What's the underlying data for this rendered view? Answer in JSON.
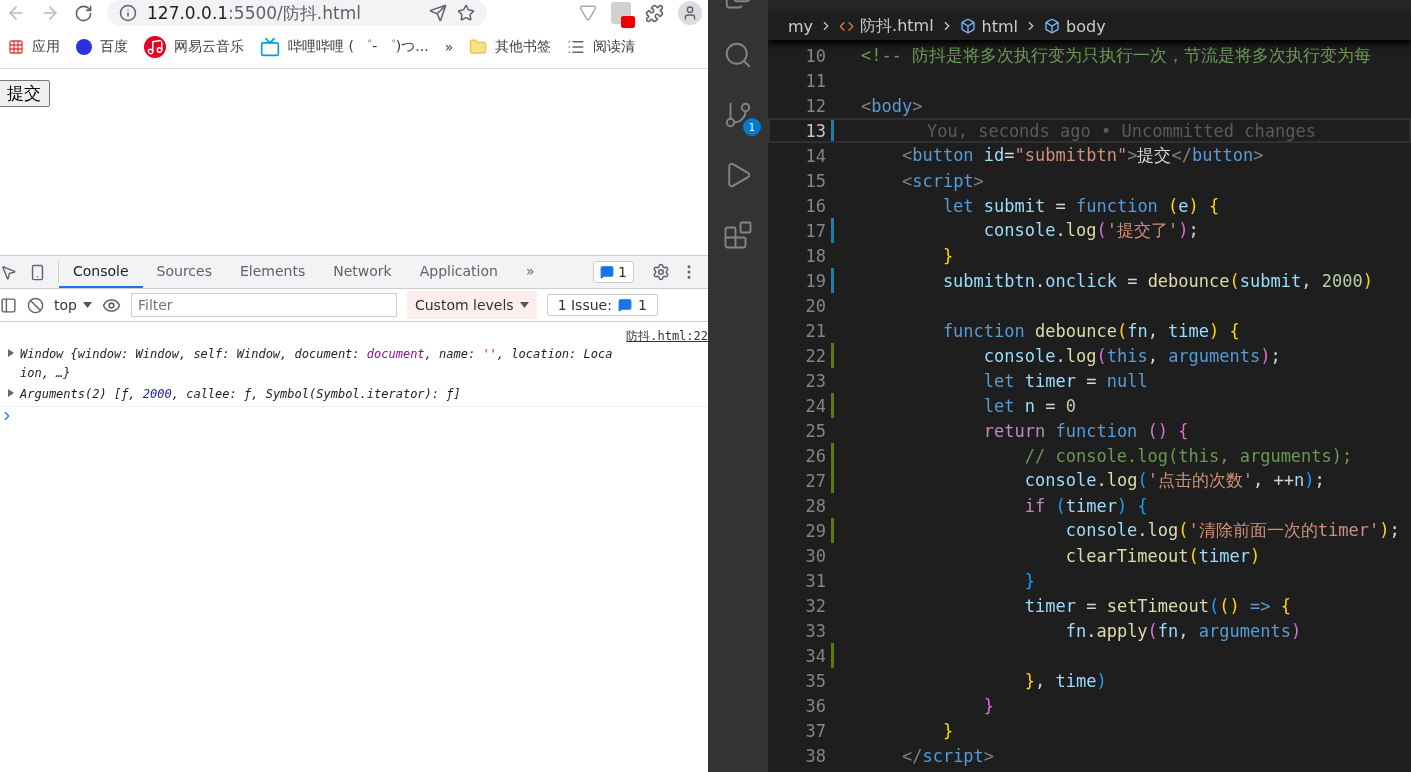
{
  "browser": {
    "address_host": "127.0.0.1",
    "address_rest": ":5500/防抖.html",
    "bookmarks": [
      {
        "label": "应用"
      },
      {
        "label": "百度"
      },
      {
        "label": "网易云音乐"
      },
      {
        "label": "哔哩哔哩 ( ゜- ゜)つ..."
      },
      {
        "label": "»"
      },
      {
        "label": "其他书签"
      },
      {
        "label": "阅读清"
      }
    ],
    "page_button": "提交"
  },
  "devtools": {
    "tabs": [
      {
        "label": "Console",
        "selected": true
      },
      {
        "label": "Sources",
        "selected": false
      },
      {
        "label": "Elements",
        "selected": false
      },
      {
        "label": "Network",
        "selected": false
      },
      {
        "label": "Application",
        "selected": false
      }
    ],
    "more_tabs": "»",
    "messages_count": "1",
    "context": "top",
    "filter_placeholder": "Filter",
    "levels": "Custom levels",
    "issues_label": "1 Issue:",
    "issues_count": "1",
    "source_link": "防抖.html:22",
    "entries": [
      {
        "lines": [
          [
            {
              "text": "Window {window: Window, self: Window, document: ",
              "kind": "plain"
            },
            {
              "text": "document",
              "kind": "object"
            },
            {
              "text": ", name: ",
              "kind": "plain"
            },
            {
              "text": "''",
              "kind": "string"
            },
            {
              "text": ", location: Loca",
              "kind": "plain"
            }
          ],
          [
            {
              "text": "ion, …}",
              "kind": "plain"
            }
          ]
        ]
      },
      {
        "lines": [
          [
            {
              "text": "Arguments(2) [ƒ, ",
              "kind": "plain"
            },
            {
              "text": "2000",
              "kind": "number"
            },
            {
              "text": ", callee: ƒ, Symbol(Symbol.iterator): ƒ]",
              "kind": "plain"
            }
          ]
        ]
      }
    ]
  },
  "vscode": {
    "scm_badge": "1",
    "breadcrumbs": [
      {
        "label": "my"
      },
      {
        "label": "防抖.html"
      },
      {
        "label": "html"
      },
      {
        "label": "body"
      }
    ],
    "lines": [
      {
        "number": "10",
        "current": false,
        "tokens": [
          {
            "text": "<!-- 防抖是将多次执行变为只执行一次，节流是将多次执行变为每",
            "kind": "comment"
          }
        ]
      },
      {
        "number": "11",
        "current": false
      },
      {
        "number": "12",
        "current": false,
        "tokens": [
          {
            "text": "<",
            "kind": "punct"
          },
          {
            "text": "body",
            "kind": "tag"
          },
          {
            "text": ">",
            "kind": "punct"
          }
        ]
      },
      {
        "number": "13",
        "current": true,
        "blame": "You, seconds ago • Uncommitted changes",
        "kind": "modified"
      },
      {
        "number": "14",
        "current": false,
        "tokens": [
          {
            "text": "    <",
            "kind": "punct"
          },
          {
            "text": "button ",
            "kind": "tag"
          },
          {
            "text": "id",
            "kind": "attr"
          },
          {
            "text": "=",
            "kind": "plain"
          },
          {
            "text": "\"submitbtn\"",
            "kind": "string"
          },
          {
            "text": ">",
            "kind": "punct"
          },
          {
            "text": "提交",
            "kind": "plain"
          },
          {
            "text": "</",
            "kind": "punct"
          },
          {
            "text": "button",
            "kind": "tag"
          },
          {
            "text": ">",
            "kind": "punct"
          }
        ]
      },
      {
        "number": "15",
        "current": false,
        "tokens": [
          {
            "text": "    <",
            "kind": "punct"
          },
          {
            "text": "script",
            "kind": "tag"
          },
          {
            "text": ">",
            "kind": "punct"
          }
        ]
      },
      {
        "number": "16",
        "current": false,
        "tokens": [
          {
            "text": "        let ",
            "kind": "keyword"
          },
          {
            "text": "submit",
            "kind": "var"
          },
          {
            "text": " = ",
            "kind": "plain"
          },
          {
            "text": "function ",
            "kind": "keyword"
          },
          {
            "text": "(",
            "kind": "bracket1"
          },
          {
            "text": "e",
            "kind": "var"
          },
          {
            "text": ")",
            "kind": "bracket1"
          },
          {
            "text": " {",
            "kind": "bracket1"
          }
        ]
      },
      {
        "number": "17",
        "current": false,
        "kind": "modified",
        "tokens": [
          {
            "text": "            console",
            "kind": "var"
          },
          {
            "text": ".",
            "kind": "plain"
          },
          {
            "text": "log",
            "kind": "fn"
          },
          {
            "text": "(",
            "kind": "bracket2"
          },
          {
            "text": "'提交了'",
            "kind": "string"
          },
          {
            "text": ")",
            "kind": "bracket2"
          },
          {
            "text": ";",
            "kind": "plain"
          }
        ]
      },
      {
        "number": "18",
        "current": false,
        "tokens": [
          {
            "text": "        }",
            "kind": "bracket1"
          }
        ]
      },
      {
        "number": "19",
        "current": false,
        "kind": "modified",
        "tokens": [
          {
            "text": "        submitbtn",
            "kind": "var"
          },
          {
            "text": ".",
            "kind": "plain"
          },
          {
            "text": "onclick",
            "kind": "var"
          },
          {
            "text": " = ",
            "kind": "plain"
          },
          {
            "text": "debounce",
            "kind": "fn"
          },
          {
            "text": "(",
            "kind": "bracket1"
          },
          {
            "text": "submit",
            "kind": "var"
          },
          {
            "text": ", ",
            "kind": "plain"
          },
          {
            "text": "2000",
            "kind": "number"
          },
          {
            "text": ")",
            "kind": "bracket1"
          }
        ]
      },
      {
        "number": "20",
        "current": false
      },
      {
        "number": "21",
        "current": false,
        "tokens": [
          {
            "text": "        function ",
            "kind": "keyword"
          },
          {
            "text": "debounce",
            "kind": "fn"
          },
          {
            "text": "(",
            "kind": "bracket1"
          },
          {
            "text": "fn",
            "kind": "var"
          },
          {
            "text": ", ",
            "kind": "plain"
          },
          {
            "text": "time",
            "kind": "var"
          },
          {
            "text": ")",
            "kind": "bracket1"
          },
          {
            "text": " {",
            "kind": "bracket1"
          }
        ]
      },
      {
        "number": "22",
        "current": false,
        "kind": "added",
        "tokens": [
          {
            "text": "            console",
            "kind": "var"
          },
          {
            "text": ".",
            "kind": "plain"
          },
          {
            "text": "log",
            "kind": "fn"
          },
          {
            "text": "(",
            "kind": "bracket2"
          },
          {
            "text": "this",
            "kind": "keyword"
          },
          {
            "text": ", ",
            "kind": "plain"
          },
          {
            "text": "arguments",
            "kind": "keyword"
          },
          {
            "text": ")",
            "kind": "bracket2"
          },
          {
            "text": ";",
            "kind": "plain"
          }
        ]
      },
      {
        "number": "23",
        "current": false,
        "tokens": [
          {
            "text": "            let ",
            "kind": "keyword"
          },
          {
            "text": "timer",
            "kind": "var"
          },
          {
            "text": " = ",
            "kind": "plain"
          },
          {
            "text": "null",
            "kind": "keyword"
          }
        ]
      },
      {
        "number": "24",
        "current": false,
        "kind": "added",
        "tokens": [
          {
            "text": "            let ",
            "kind": "keyword"
          },
          {
            "text": "n",
            "kind": "var"
          },
          {
            "text": " = ",
            "kind": "plain"
          },
          {
            "text": "0",
            "kind": "number"
          }
        ]
      },
      {
        "number": "25",
        "current": false,
        "tokens": [
          {
            "text": "            return ",
            "kind": "control"
          },
          {
            "text": "function ",
            "kind": "keyword"
          },
          {
            "text": "()",
            "kind": "bracket2"
          },
          {
            "text": " {",
            "kind": "bracket2"
          }
        ]
      },
      {
        "number": "26",
        "current": false,
        "kind": "added",
        "tokens": [
          {
            "text": "                // console.log(this, arguments);",
            "kind": "comment"
          }
        ]
      },
      {
        "number": "27",
        "current": false,
        "kind": "added",
        "tokens": [
          {
            "text": "                console",
            "kind": "var"
          },
          {
            "text": ".",
            "kind": "plain"
          },
          {
            "text": "log",
            "kind": "fn"
          },
          {
            "text": "(",
            "kind": "bracket3"
          },
          {
            "text": "'点击的次数'",
            "kind": "string"
          },
          {
            "text": ", ++",
            "kind": "plain"
          },
          {
            "text": "n",
            "kind": "var"
          },
          {
            "text": ")",
            "kind": "bracket3"
          },
          {
            "text": ";",
            "kind": "plain"
          }
        ]
      },
      {
        "number": "28",
        "current": false,
        "tokens": [
          {
            "text": "                if ",
            "kind": "control"
          },
          {
            "text": "(",
            "kind": "bracket3"
          },
          {
            "text": "timer",
            "kind": "var"
          },
          {
            "text": ")",
            "kind": "bracket3"
          },
          {
            "text": " {",
            "kind": "bracket3"
          }
        ]
      },
      {
        "number": "29",
        "current": false,
        "kind": "added",
        "tokens": [
          {
            "text": "                    console",
            "kind": "var"
          },
          {
            "text": ".",
            "kind": "plain"
          },
          {
            "text": "log",
            "kind": "fn"
          },
          {
            "text": "(",
            "kind": "bracket1"
          },
          {
            "text": "'清除前面一次的timer'",
            "kind": "string"
          },
          {
            "text": ")",
            "kind": "bracket1"
          },
          {
            "text": ";",
            "kind": "plain"
          }
        ]
      },
      {
        "number": "30",
        "current": false,
        "tokens": [
          {
            "text": "                    clearTimeout",
            "kind": "fn"
          },
          {
            "text": "(",
            "kind": "bracket1"
          },
          {
            "text": "timer",
            "kind": "var"
          },
          {
            "text": ")",
            "kind": "bracket1"
          }
        ]
      },
      {
        "number": "31",
        "current": false,
        "tokens": [
          {
            "text": "                }",
            "kind": "bracket3"
          }
        ]
      },
      {
        "number": "32",
        "current": false,
        "tokens": [
          {
            "text": "                timer",
            "kind": "var"
          },
          {
            "text": " = ",
            "kind": "plain"
          },
          {
            "text": "setTimeout",
            "kind": "fn"
          },
          {
            "text": "(",
            "kind": "bracket3"
          },
          {
            "text": "()",
            "kind": "bracket1"
          },
          {
            "text": " => ",
            "kind": "keyword"
          },
          {
            "text": "{",
            "kind": "bracket1"
          }
        ]
      },
      {
        "number": "33",
        "current": false,
        "tokens": [
          {
            "text": "                    fn",
            "kind": "var"
          },
          {
            "text": ".",
            "kind": "plain"
          },
          {
            "text": "apply",
            "kind": "fn"
          },
          {
            "text": "(",
            "kind": "bracket2"
          },
          {
            "text": "fn",
            "kind": "var"
          },
          {
            "text": ", ",
            "kind": "plain"
          },
          {
            "text": "arguments",
            "kind": "keyword"
          },
          {
            "text": ")",
            "kind": "bracket2"
          }
        ]
      },
      {
        "number": "34",
        "current": false,
        "kind": "added"
      },
      {
        "number": "35",
        "current": false,
        "tokens": [
          {
            "text": "                }",
            "kind": "bracket1"
          },
          {
            "text": ", ",
            "kind": "plain"
          },
          {
            "text": "time",
            "kind": "var"
          },
          {
            "text": ")",
            "kind": "bracket3"
          }
        ]
      },
      {
        "number": "36",
        "current": false,
        "tokens": [
          {
            "text": "            }",
            "kind": "bracket2"
          }
        ]
      },
      {
        "number": "37",
        "current": false,
        "tokens": [
          {
            "text": "        }",
            "kind": "bracket1"
          }
        ]
      },
      {
        "number": "38",
        "current": false,
        "tokens": [
          {
            "text": "    </",
            "kind": "punct"
          },
          {
            "text": "script",
            "kind": "tag"
          },
          {
            "text": ">",
            "kind": "punct"
          }
        ]
      }
    ]
  }
}
